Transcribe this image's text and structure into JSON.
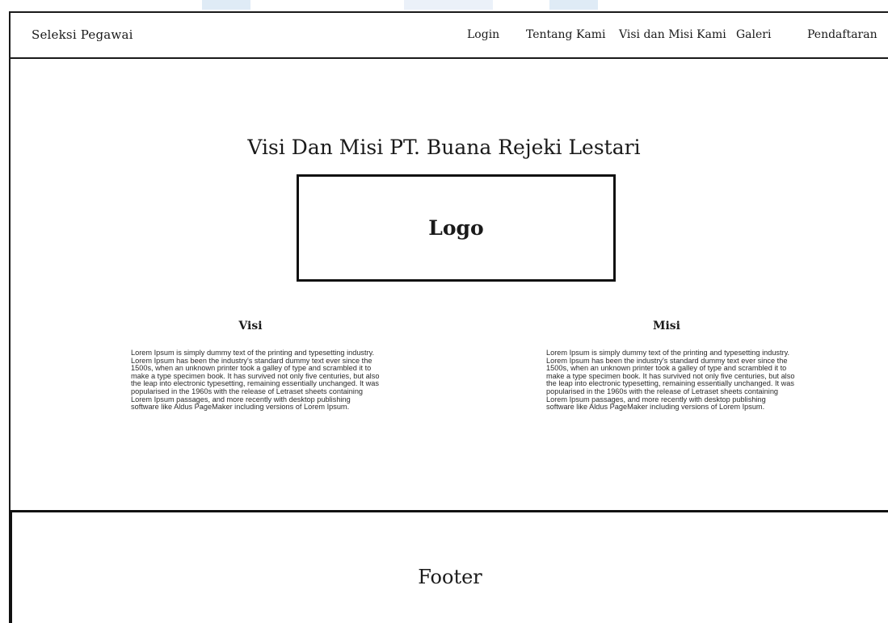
{
  "navbar": {
    "brand": "Seleksi Pegawai",
    "links": [
      {
        "label": "Login"
      },
      {
        "label": "Tentang Kami"
      },
      {
        "label": "Visi dan Misi Kami"
      },
      {
        "label": "Galeri"
      },
      {
        "label": "Pendaftaran"
      }
    ]
  },
  "main": {
    "title": "Visi Dan Misi PT. Buana Rejeki Lestari",
    "logo_label": "Logo",
    "visi": {
      "heading": "Visi",
      "body": "Lorem Ipsum is simply dummy text of the printing and typesetting industry. Lorem Ipsum has been the industry's standard dummy text ever since the 1500s, when an unknown printer took a galley of type and scrambled it to make a type specimen book. It has survived not only five centuries, but also the leap into electronic typesetting, remaining essentially unchanged. It was popularised in the 1960s with the release of Letraset sheets containing Lorem Ipsum passages, and more recently with desktop publishing software like Aldus PageMaker including versions of Lorem Ipsum."
    },
    "misi": {
      "heading": "Misi",
      "body": "Lorem Ipsum is simply dummy text of the printing and typesetting industry. Lorem Ipsum has been the industry's standard dummy text ever since the 1500s, when an unknown printer took a galley of type and scrambled it to make a type specimen book. It has survived not only five centuries, but also the leap into electronic typesetting, remaining essentially unchanged. It was popularised in the 1960s with the release of Letraset sheets containing Lorem Ipsum passages, and more recently with desktop publishing software like Aldus PageMaker including versions of Lorem Ipsum."
    }
  },
  "footer": {
    "label": "Footer"
  }
}
